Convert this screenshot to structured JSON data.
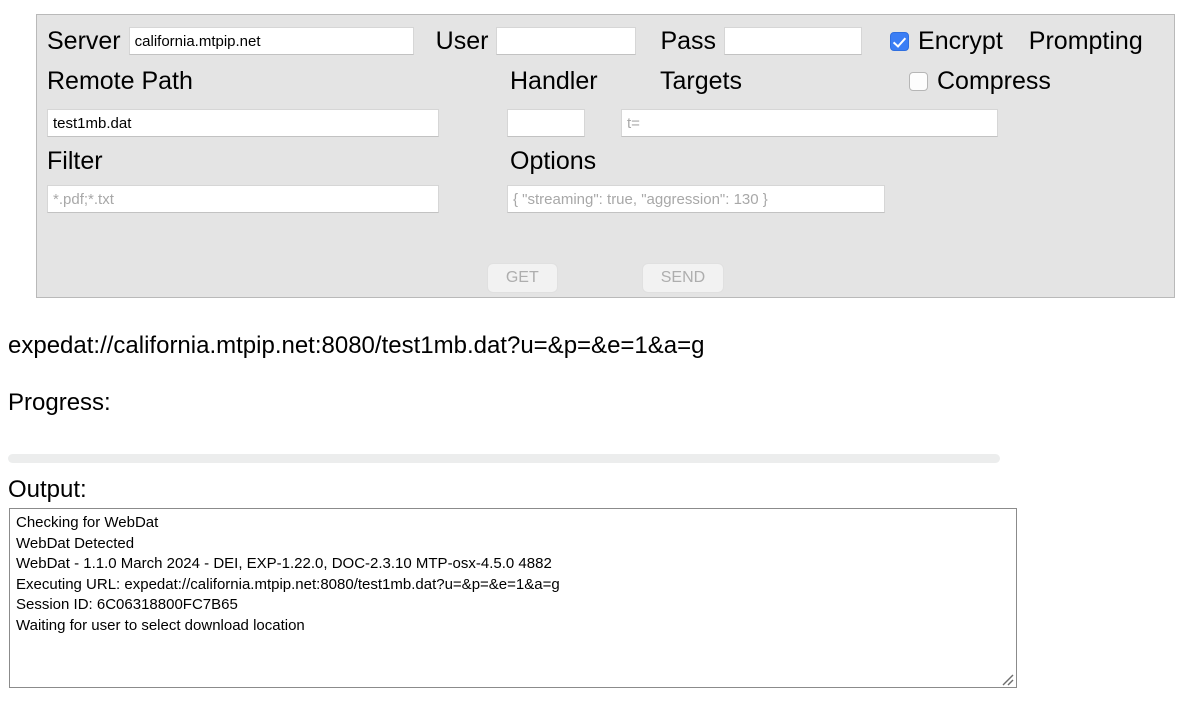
{
  "form": {
    "server": {
      "label": "Server",
      "value": "california.mtpip.net",
      "placeholder": ""
    },
    "user": {
      "label": "User",
      "value": "",
      "placeholder": ""
    },
    "pass": {
      "label": "Pass",
      "value": "",
      "placeholder": ""
    },
    "encrypt": {
      "label": "Encrypt",
      "checked": true,
      "accent": "#3b7ef5"
    },
    "prompting": {
      "label": "Prompting"
    },
    "remote_path": {
      "label": "Remote Path",
      "value": "test1mb.dat",
      "placeholder": ""
    },
    "handler": {
      "label": "Handler",
      "value": "",
      "placeholder": ""
    },
    "targets": {
      "label": "Targets",
      "value": "",
      "placeholder": "t="
    },
    "compress": {
      "label": "Compress",
      "checked": false
    },
    "filter": {
      "label": "Filter",
      "value": "",
      "placeholder": "*.pdf;*.txt"
    },
    "options": {
      "label": "Options",
      "value": "",
      "placeholder": "{ \"streaming\": true, \"aggression\": 130 }"
    },
    "buttons": {
      "get_label": "GET",
      "send_label": "SEND"
    }
  },
  "url_line": "expedat://california.mtpip.net:8080/test1mb.dat?u=&p=&e=1&a=g",
  "progress": {
    "label": "Progress:",
    "percent": 0
  },
  "output": {
    "label": "Output:",
    "lines": [
      "Checking for WebDat",
      "WebDat Detected",
      "WebDat - 1.1.0 March 2024 - DEI, EXP-1.22.0, DOC-2.3.10 MTP-osx-4.5.0 4882",
      "Executing URL: expedat://california.mtpip.net:8080/test1mb.dat?u=&p=&e=1&a=g",
      "Session ID: 6C06318800FC7B65",
      "Waiting for user to select download location"
    ],
    "resize_grip_icon": "resize-grip-icon"
  }
}
